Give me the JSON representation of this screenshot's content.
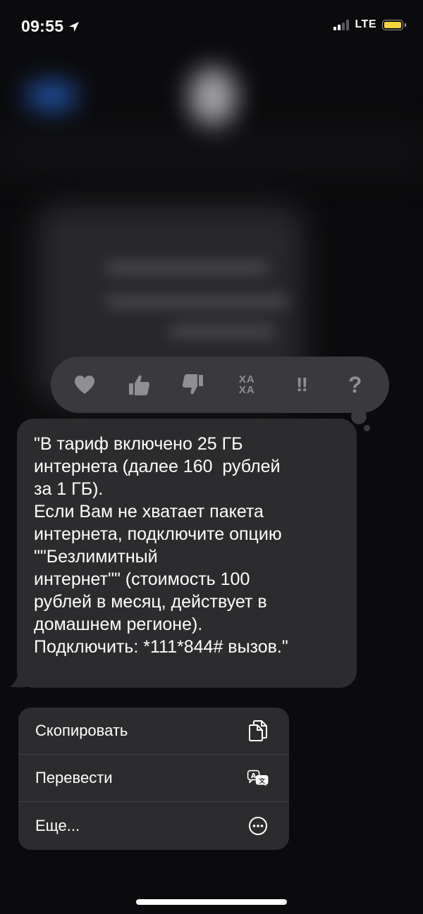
{
  "status_bar": {
    "time": "09:55",
    "network": "LTE",
    "battery_color": "#f5d33a"
  },
  "reactions": [
    {
      "name": "heart-icon"
    },
    {
      "name": "thumbs-up-icon"
    },
    {
      "name": "thumbs-down-icon"
    },
    {
      "name": "haha-icon",
      "lines": [
        "ХА",
        "ХА"
      ]
    },
    {
      "name": "exclamation-icon",
      "text": "‼"
    },
    {
      "name": "question-icon",
      "text": "?"
    }
  ],
  "message": {
    "text": "\"В тариф включено 25 ГБ\nинтернета (далее 160  рублей\nза 1 ГБ).\nЕсли Вам не хватает пакета\nинтернета, подключите опцию\n\"\"Безлимитный\nинтернет\"\" (стоимость 100\nрублей в месяц, действует в\nдомашнем регионе).\nПодключить: *111*844# вызов.\""
  },
  "context_menu": {
    "items": [
      {
        "label": "Скопировать",
        "icon": "copy-icon"
      },
      {
        "label": "Перевести",
        "icon": "translate-icon",
        "icon_glyphs": [
          "A",
          "文"
        ]
      },
      {
        "label": "Еще...",
        "icon": "more-icon"
      }
    ]
  }
}
